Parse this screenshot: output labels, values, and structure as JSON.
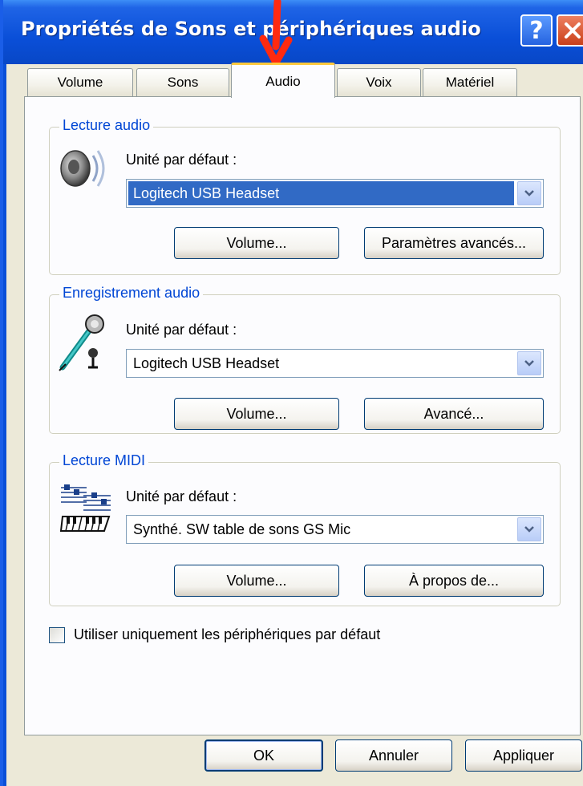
{
  "window": {
    "title": "Propriétés de Sons et périphériques audio",
    "help_label": "?",
    "close_label": "✕"
  },
  "tabs": [
    {
      "label": "Volume",
      "active": false
    },
    {
      "label": "Sons",
      "active": false
    },
    {
      "label": "Audio",
      "active": true
    },
    {
      "label": "Voix",
      "active": false
    },
    {
      "label": "Matériel",
      "active": false
    }
  ],
  "playback": {
    "group_label": "Lecture audio",
    "icon": "speaker-icon",
    "field_label": "Unité par défaut :",
    "device": "Logitech USB Headset",
    "volume_button": "Volume...",
    "advanced_button": "Paramètres avancés..."
  },
  "recording": {
    "group_label": "Enregistrement audio",
    "icon": "microphone-icon",
    "field_label": "Unité par défaut :",
    "device": "Logitech USB Headset",
    "volume_button": "Volume...",
    "advanced_button": "Avancé..."
  },
  "midi": {
    "group_label": "Lecture MIDI",
    "icon": "midi-keyboard-icon",
    "field_label": "Unité par défaut :",
    "device": "Synthé. SW table de sons GS Mic",
    "volume_button": "Volume...",
    "about_button": "À propos de..."
  },
  "checkbox": {
    "label": "Utiliser uniquement les périphériques par défaut",
    "checked": false
  },
  "footer": {
    "ok": "OK",
    "cancel": "Annuler",
    "apply": "Appliquer"
  },
  "colors": {
    "title_bar": "#0a4fd8",
    "group_label": "#0046d5",
    "selection": "#316ac5",
    "annotation_arrow": "#ff2a10"
  }
}
